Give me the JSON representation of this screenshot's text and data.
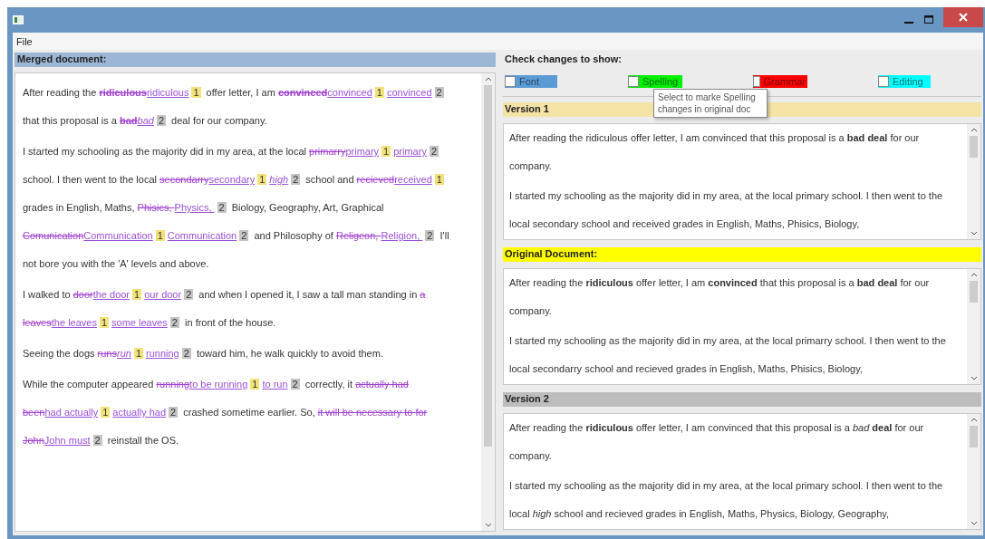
{
  "menu": [
    {
      "label": "File"
    }
  ],
  "merged": {
    "title": "Merged document:",
    "paragraphs": [
      {
        "lines": [
          [
            {
              "kind": "text",
              "text": "After reading the "
            },
            {
              "kind": "deleted_bold",
              "text": "ridiculous"
            },
            {
              "kind": "inserted",
              "text": "ridiculous"
            },
            {
              "kind": "tag",
              "text": "1",
              "color": "#f2e27a"
            },
            {
              "kind": "text",
              "text": " offer letter, I am "
            },
            {
              "kind": "deleted_bold",
              "text": "convinced"
            },
            {
              "kind": "inserted",
              "text": "convinced"
            },
            {
              "kind": "tag",
              "text": "1",
              "color": "#f2e27a"
            },
            {
              "kind": "inserted",
              "text": "convinced"
            },
            {
              "kind": "tag",
              "text": "2",
              "color": "#c4c4c4"
            }
          ],
          [
            {
              "kind": "text",
              "text": "that this proposal is a "
            },
            {
              "kind": "deleted_bold",
              "text": "bad"
            },
            {
              "kind": "inserted_italic",
              "text": "bad"
            },
            {
              "kind": "tag",
              "text": "2",
              "color": "#c4c4c4"
            },
            {
              "kind": "text",
              "text": " deal for our company."
            }
          ]
        ]
      },
      {
        "lines": [
          [
            {
              "kind": "text",
              "text": "I started my schooling as the majority did in my area, at the local "
            },
            {
              "kind": "deleted",
              "text": "primarry"
            },
            {
              "kind": "inserted",
              "text": "primary"
            },
            {
              "kind": "tag",
              "text": "1",
              "color": "#f2e27a"
            },
            {
              "kind": "inserted",
              "text": "primary"
            },
            {
              "kind": "tag",
              "text": "2",
              "color": "#c4c4c4"
            }
          ],
          [
            {
              "kind": "text",
              "text": "school. I then went to the local "
            },
            {
              "kind": "deleted",
              "text": "secondarry"
            },
            {
              "kind": "inserted",
              "text": "secondary"
            },
            {
              "kind": "tag",
              "text": "1",
              "color": "#f2e27a"
            },
            {
              "kind": "inserted_italic",
              "text": "high"
            },
            {
              "kind": "tag",
              "text": "2",
              "color": "#c4c4c4"
            },
            {
              "kind": "text",
              "text": " school and "
            },
            {
              "kind": "deleted",
              "text": "recieved"
            },
            {
              "kind": "inserted",
              "text": "received"
            },
            {
              "kind": "tag",
              "text": "1",
              "color": "#f2e27a"
            }
          ],
          [
            {
              "kind": "text",
              "text": "grades in English, Maths, "
            },
            {
              "kind": "deleted",
              "text": "Phisics, "
            },
            {
              "kind": "inserted",
              "text": "Physics, "
            },
            {
              "kind": "tag",
              "text": "2",
              "color": "#c4c4c4"
            },
            {
              "kind": "text",
              "text": " Biology, Geography, Art, Graphical"
            }
          ],
          [
            {
              "kind": "deleted",
              "text": "Comunication"
            },
            {
              "kind": "inserted",
              "text": "Communication"
            },
            {
              "kind": "tag",
              "text": "1",
              "color": "#f2e27a"
            },
            {
              "kind": "inserted",
              "text": "Communication"
            },
            {
              "kind": "tag",
              "text": "2",
              "color": "#c4c4c4"
            },
            {
              "kind": "text",
              "text": " and Philosophy of "
            },
            {
              "kind": "deleted",
              "text": "Religeon, "
            },
            {
              "kind": "inserted",
              "text": "Religion, "
            },
            {
              "kind": "tag",
              "text": "2",
              "color": "#c4c4c4"
            },
            {
              "kind": "text",
              "text": " I'll"
            }
          ],
          [
            {
              "kind": "text",
              "text": "not bore you with the 'A' levels and above."
            }
          ]
        ]
      },
      {
        "lines": [
          [
            {
              "kind": "text",
              "text": "I walked to "
            },
            {
              "kind": "deleted",
              "text": "door"
            },
            {
              "kind": "inserted",
              "text": "the door"
            },
            {
              "kind": "tag",
              "text": "1",
              "color": "#f2e27a"
            },
            {
              "kind": "inserted",
              "text": "our door"
            },
            {
              "kind": "tag",
              "text": "2",
              "color": "#c4c4c4"
            },
            {
              "kind": "text",
              "text": " and when I opened it, I saw a tall man standing in "
            },
            {
              "kind": "deleted",
              "text": "a"
            }
          ],
          [
            {
              "kind": "deleted",
              "text": "leaves"
            },
            {
              "kind": "inserted",
              "text": "the leaves"
            },
            {
              "kind": "tag",
              "text": "1",
              "color": "#f2e27a"
            },
            {
              "kind": "inserted",
              "text": "some leaves"
            },
            {
              "kind": "tag",
              "text": "2",
              "color": "#c4c4c4"
            },
            {
              "kind": "text",
              "text": " in front of the house."
            }
          ]
        ]
      },
      {
        "lines": [
          [
            {
              "kind": "text",
              "text": "Seeing the dogs "
            },
            {
              "kind": "deleted",
              "text": "runs"
            },
            {
              "kind": "inserted_italic",
              "text": "run"
            },
            {
              "kind": "tag",
              "text": "1",
              "color": "#f2e27a"
            },
            {
              "kind": "inserted",
              "text": "running"
            },
            {
              "kind": "tag",
              "text": "2",
              "color": "#c4c4c4"
            },
            {
              "kind": "text",
              "text": " toward him, he walk quickly to avoid them."
            }
          ]
        ]
      },
      {
        "lines": [
          [
            {
              "kind": "text",
              "text": "While the computer appeared "
            },
            {
              "kind": "deleted",
              "text": "running"
            },
            {
              "kind": "inserted",
              "text": "to be running"
            },
            {
              "kind": "tag",
              "text": "1",
              "color": "#f2e27a"
            },
            {
              "kind": "inserted",
              "text": "to run"
            },
            {
              "kind": "tag",
              "text": "2",
              "color": "#c4c4c4"
            },
            {
              "kind": "text",
              "text": " correctly, it "
            },
            {
              "kind": "deleted",
              "text": "actually had"
            }
          ],
          [
            {
              "kind": "deleted",
              "text": "been"
            },
            {
              "kind": "inserted",
              "text": "had actually"
            },
            {
              "kind": "tag",
              "text": "1",
              "color": "#f2e27a"
            },
            {
              "kind": "inserted",
              "text": "actually had"
            },
            {
              "kind": "tag",
              "text": "2",
              "color": "#c4c4c4"
            },
            {
              "kind": "text",
              "text": " crashed sometime earlier. So, "
            },
            {
              "kind": "deleted",
              "text": "it will be necessary to for"
            }
          ],
          [
            {
              "kind": "deleted",
              "text": "John"
            },
            {
              "kind": "inserted",
              "text": "John must"
            },
            {
              "kind": "tag",
              "text": "2",
              "color": "#c4c4c4"
            },
            {
              "kind": "text",
              "text": " reinstall the OS."
            }
          ]
        ]
      }
    ]
  },
  "check_changes": {
    "title": "Check changes to show:",
    "options": [
      {
        "label": "Font",
        "checked": false,
        "color": "#5b9bd5"
      },
      {
        "label": "Spelling",
        "checked": false,
        "color": "#00f000"
      },
      {
        "label": "Grammar",
        "checked": false,
        "color": "#ff0000"
      },
      {
        "label": "Editing",
        "checked": false,
        "color": "#00ffff"
      }
    ],
    "tooltip": "Select to marke Spelling changes in original doc"
  },
  "sections": [
    {
      "title": "Version 1",
      "color": "#f3e4a6",
      "paragraphs": [
        "After reading the ridiculous offer letter, I am convinced that this proposal is a **bad deal** for our company.",
        "I started my schooling as the majority did in my area, at the local primary school. I then went to the local secondary school and received grades in English, Maths, Phisics, Biology,"
      ]
    },
    {
      "title": "Original Document:",
      "color": "#ffff00",
      "paragraphs": [
        "After reading the **ridiculous** offer letter, I am **convinced** that this proposal is a **bad deal** for our company.",
        "I started my schooling as the majority did in my area, at the local primarry school. I then went to the local secondarry school and recieved grades in English, Maths, Phisics, Biology,"
      ]
    },
    {
      "title": "Version 2",
      "color": "#bdbdbd",
      "paragraphs": [
        "After reading the **ridiculous** offer letter, I am convinced that this proposal is a *bad* **deal** for our company.",
        "I started my schooling as the majority did in my area, at the local primary school. I then went to the local *high* school and recieved grades in English, Maths, Physics, Biology, Geography,"
      ]
    }
  ]
}
